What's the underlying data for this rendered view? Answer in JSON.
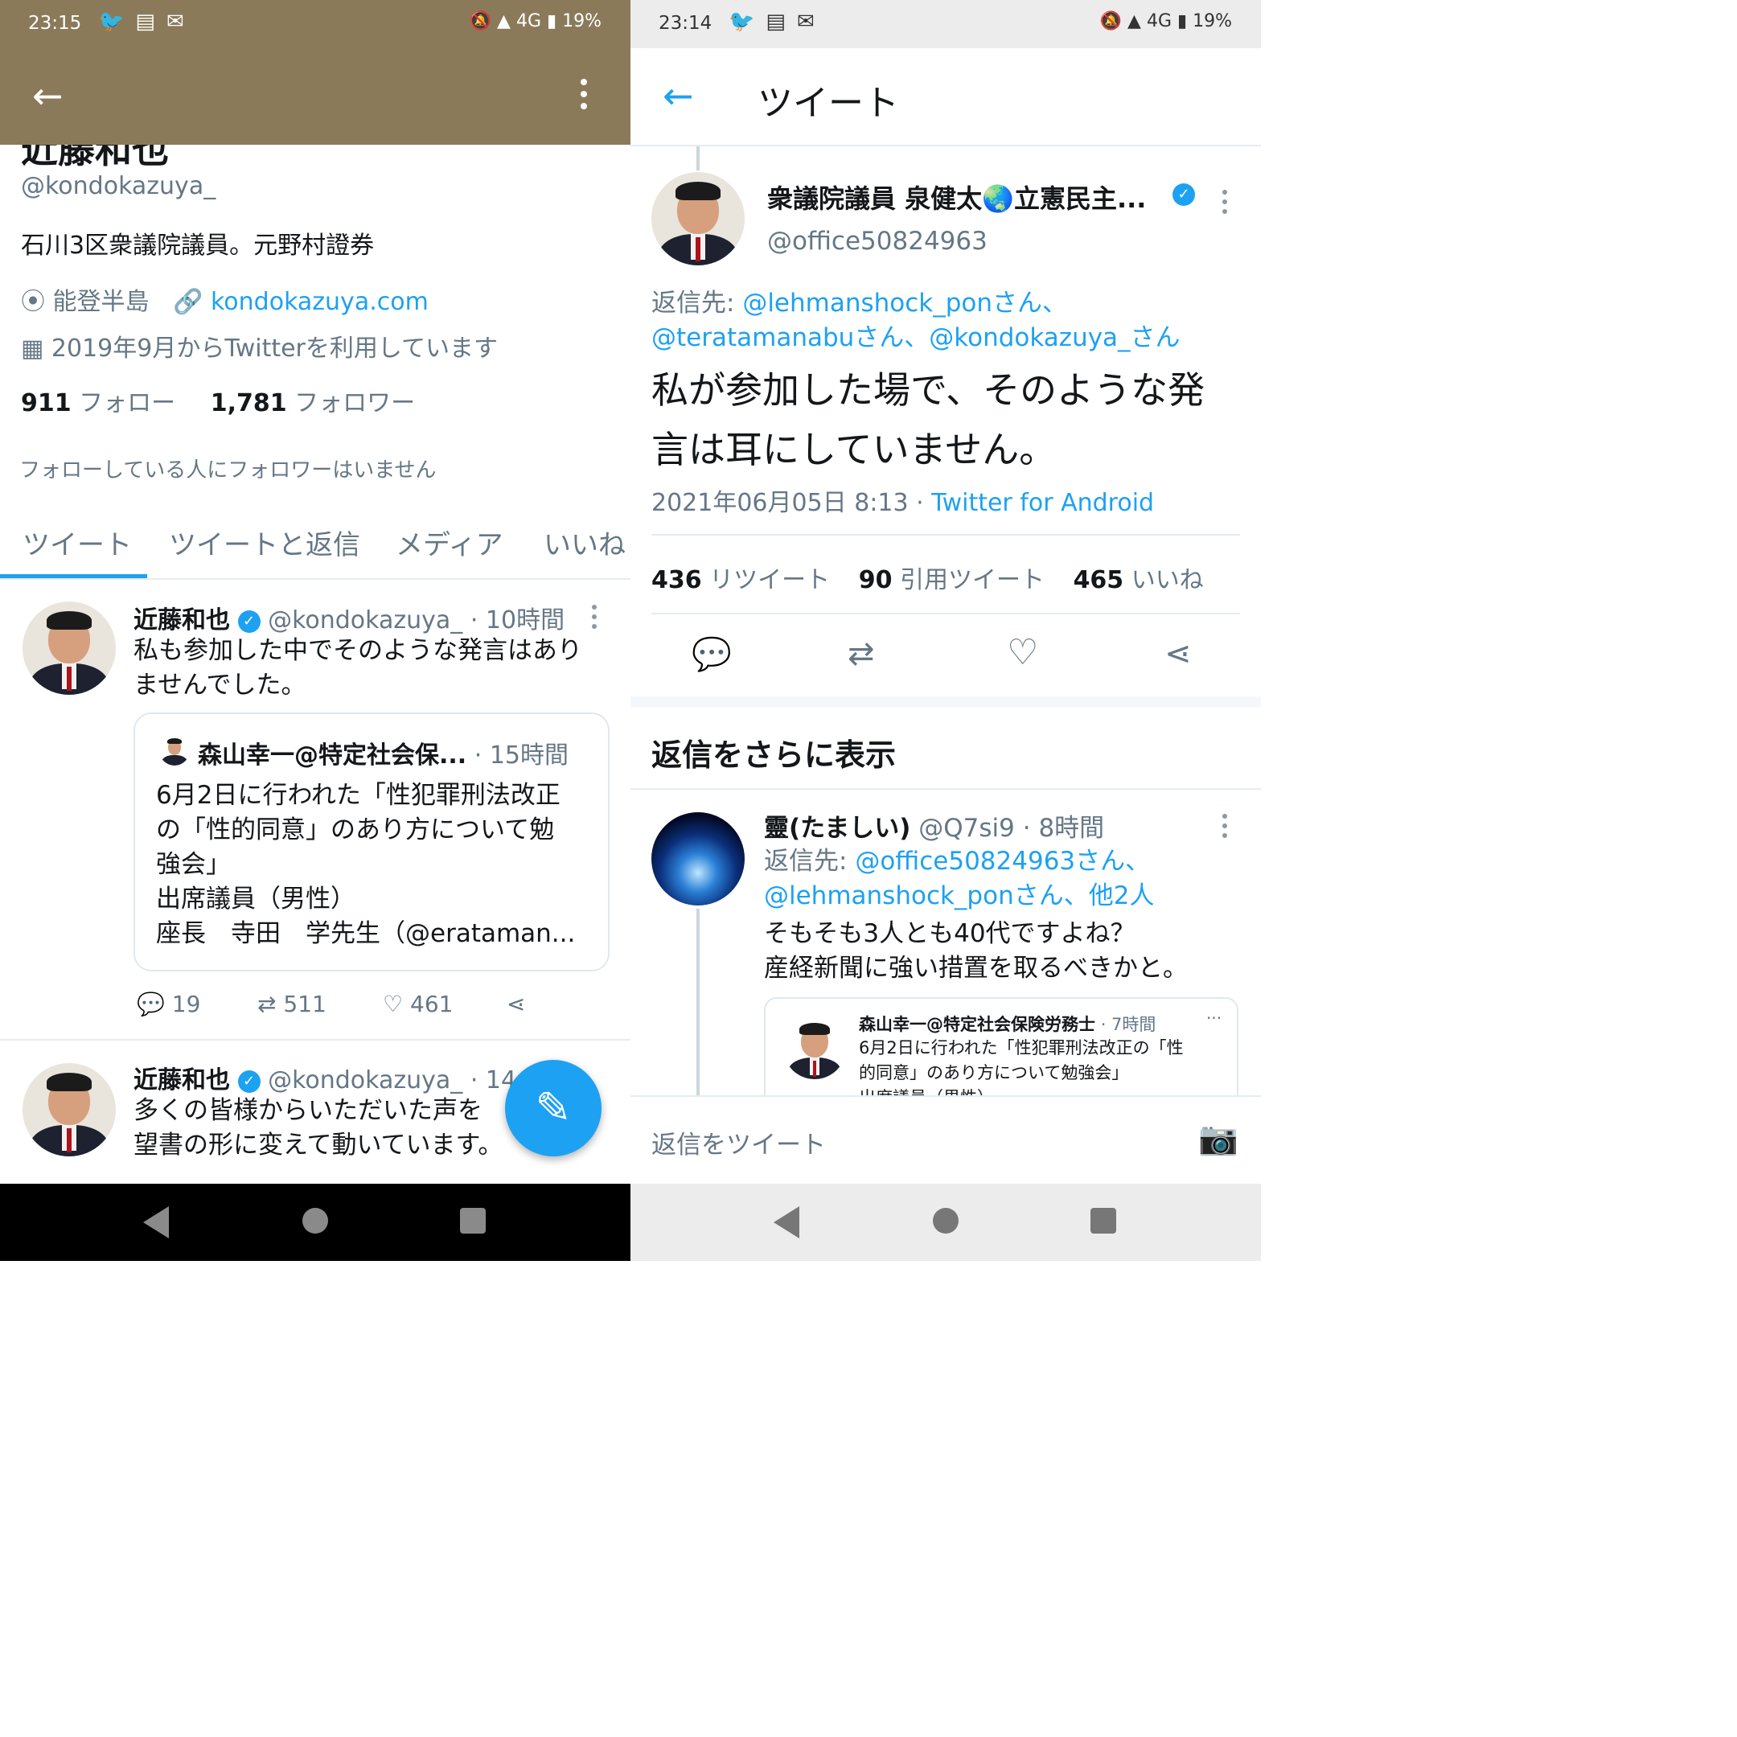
{
  "left": {
    "status": {
      "time": "23:15",
      "battery": "19%",
      "network": "4G"
    },
    "profile": {
      "name_partial": "近藤和也",
      "handle": "@kondokazuya_",
      "bio": "石川3区衆議院議員。元野村證券",
      "location": "能登半島",
      "url": "kondokazuya.com",
      "joined": "2019年9月からTwitterを利用しています",
      "following_count": "911",
      "following_label": "フォロー",
      "followers_count": "1,781",
      "followers_label": "フォロワー",
      "mutual_note": "フォローしている人にフォロワーはいません"
    },
    "tabs": [
      "ツイート",
      "ツイートと返信",
      "メディア",
      "いいね"
    ],
    "tweet1": {
      "name": "近藤和也",
      "handle": "@kondokazuya_",
      "time": "· 10時間",
      "text_line1": "私も参加した中でそのような発言はあり",
      "text_line2": "ませんでした。",
      "quote": {
        "name": "森山幸一@特定社会保...",
        "time": "· 15時間",
        "lines": [
          "6月2日に行われた「性犯罪刑法改正",
          "の「性的同意」のあり方について勉",
          "強会」",
          "出席議員（男性）",
          "座長　寺田　学先生（@erataman..."
        ]
      },
      "replies": "19",
      "retweets": "511",
      "likes": "461"
    },
    "tweet2": {
      "name": "近藤和也",
      "handle": "@kondokazuya_",
      "time": "· 14",
      "text_line1": "多くの皆様からいただいた声を",
      "text_line2": "望書の形に変えて動いています。"
    }
  },
  "right": {
    "status": {
      "time": "23:14",
      "battery": "19%",
      "network": "4G"
    },
    "header_title": "ツイート",
    "main": {
      "name": "衆議院議員 泉健太🌏立憲民主...",
      "handle": "@office50824963",
      "reply_prefix": "返信先: ",
      "reply_line1": "@lehmanshock_ponさん、",
      "reply_line2": "@teratamanabuさん、@kondokazuya_さん",
      "text_line1": "私が参加した場で、そのような発",
      "text_line2": "言は耳にしていません。",
      "timestamp": "2021年06月05日 8:13 · ",
      "client": "Twitter for Android",
      "retweets": "436",
      "retweets_label": "リツイート",
      "quotes": "90",
      "quotes_label": "引用ツイート",
      "likes": "465",
      "likes_label": "いいね"
    },
    "more_replies": "返信をさらに表示",
    "reply": {
      "name": "靈(たましい)",
      "handle": "@Q7si9",
      "time": "· 8時間",
      "reply_prefix": "返信先: ",
      "reply_line1": "@office50824963さん、",
      "reply_line2": "@lehmanshock_ponさん、他2人",
      "text_line1": "そもそも3人とも40代ですよね？",
      "text_line2": "産経新聞に強い措置を取るべきかと。",
      "quote": {
        "name": "森山幸一@特定社会保険労務士",
        "time": "· 7時間",
        "line1": "6月2日に行われた「性犯罪刑法改正の「性",
        "line2": "的同意」のあり方について勉強会」",
        "line3": "出席議員（男性）"
      }
    },
    "compose_placeholder": "返信をツイート"
  }
}
